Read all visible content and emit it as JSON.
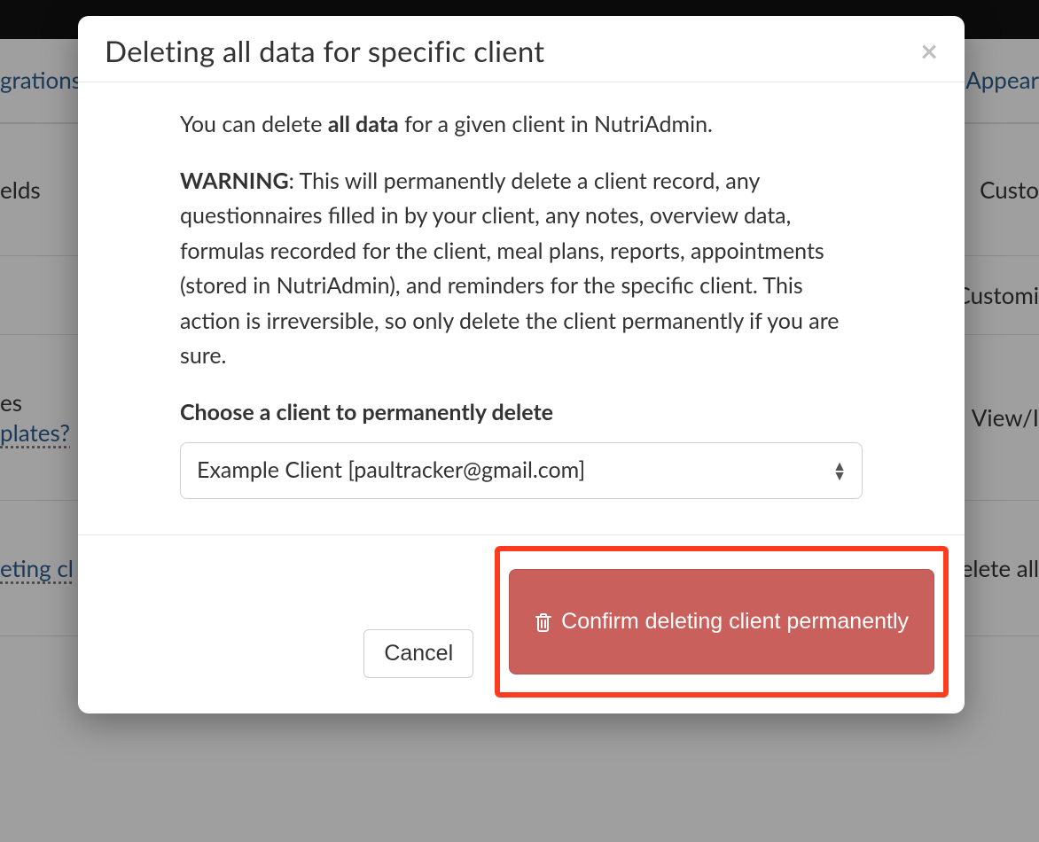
{
  "background": {
    "tab_left": "grations",
    "tab_right": "Appear",
    "row_fields_left": "elds",
    "row_fields_right": "Custo",
    "row_customi_right": "Customi",
    "row_templates_left1": "es",
    "row_templates_left2": "plates?",
    "row_templates_right": "View/I",
    "row_deleting_left": "eting cl",
    "row_deleting_right": "elete all"
  },
  "modal": {
    "title": "Deleting all data for specific client",
    "intro": {
      "prefix": "You can delete ",
      "bold": "all data",
      "suffix": " for a given client in NutriAdmin."
    },
    "warning": {
      "label": "WARNING",
      "text": ": This will permanently delete a client record, any questionnaires filled in by your client, any notes, overview data, formulas recorded for the client, meal plans, reports, appointments (stored in NutriAdmin), and reminders for the specific client. This action is irreversible, so only delete the client permanently if you are sure."
    },
    "select_label": "Choose a client to permanently delete",
    "selected_client": "Example Client [paultracker@gmail.com]",
    "cancel_label": "Cancel",
    "confirm_label": "Confirm deleting client permanently"
  },
  "colors": {
    "danger": "#c9605b",
    "highlight": "#ff3b1f"
  }
}
